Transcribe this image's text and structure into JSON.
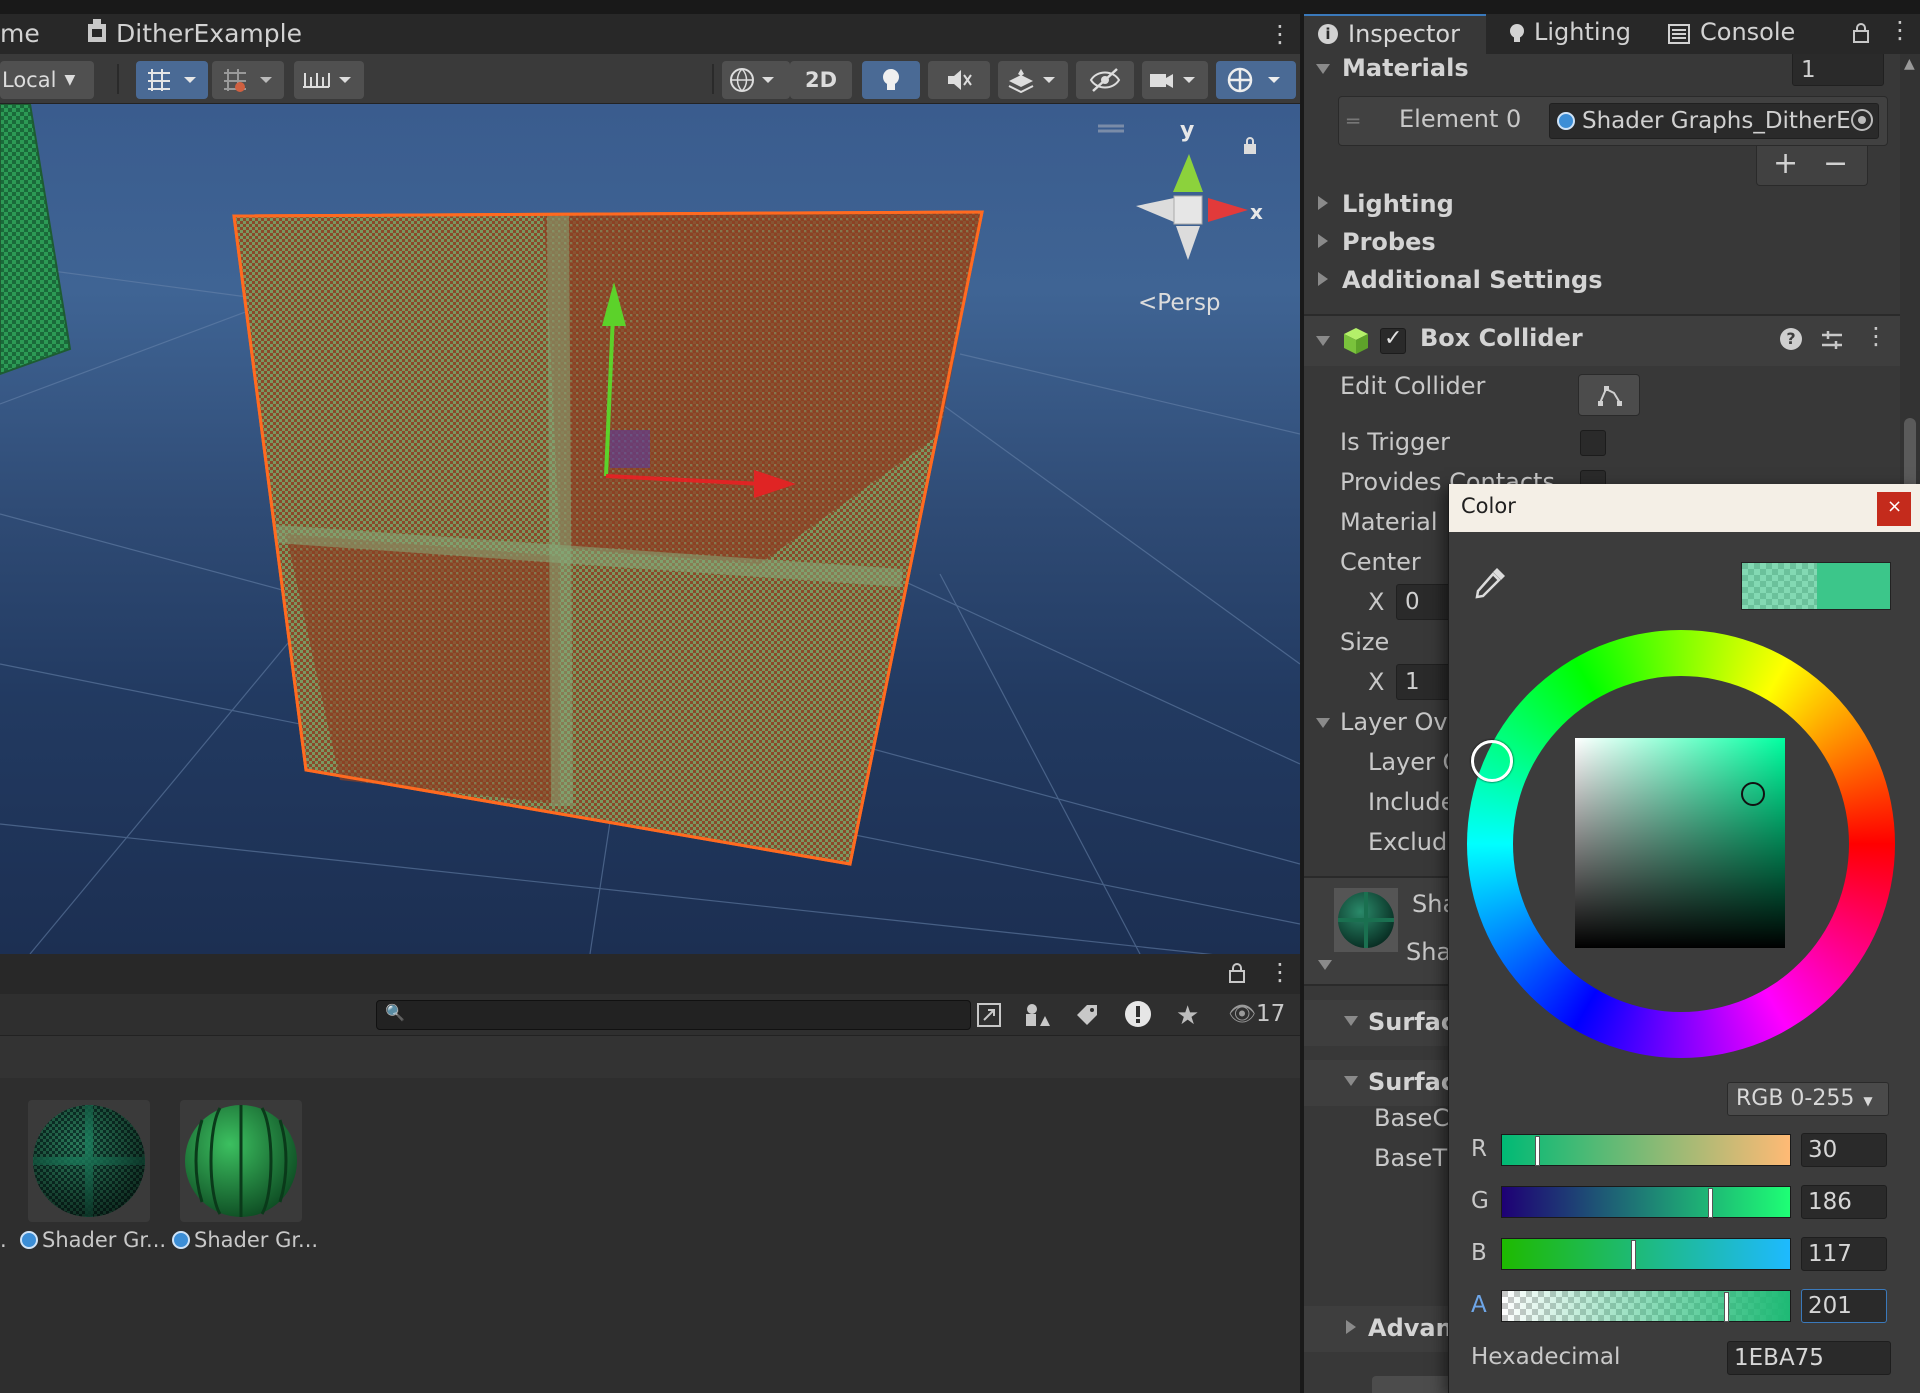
{
  "scene_window": {
    "tab_partial": "me",
    "tab_title": "DitherExample",
    "pivot_dropdown": "Local",
    "toggle_2d": "2D",
    "view_label": "Persp",
    "gizmo_y": "y",
    "gizmo_x": "x"
  },
  "project_window": {
    "search_placeholder": "",
    "hidden_count": "17",
    "assets": [
      {
        "label": "Shader Gr..."
      },
      {
        "label": "Shader Gr..."
      }
    ],
    "partial_label": "."
  },
  "inspector": {
    "tabs": [
      {
        "label": "Inspector",
        "icon": "info-icon"
      },
      {
        "label": "Lighting",
        "icon": "lightbulb-icon"
      },
      {
        "label": "Console",
        "icon": "console-icon"
      }
    ],
    "materials_label": "Materials",
    "materials_count": "1",
    "element0_label": "Element 0",
    "element0_value": "Shader Graphs_DitherE",
    "sections": [
      "Lighting",
      "Probes",
      "Additional Settings"
    ],
    "box_collider": {
      "title": "Box Collider",
      "edit_collider": "Edit Collider",
      "is_trigger": "Is Trigger",
      "provides_contacts": "Provides Contacts",
      "material": "Material",
      "center": "Center",
      "center_x_label": "X",
      "center_x": "0",
      "size": "Size",
      "size_x_label": "X",
      "size_x": "1",
      "layer_overrides": "Layer Ove",
      "layer_priority": "Layer O",
      "include_layers": "Include",
      "exclude_layers": "Exclude"
    },
    "material_header": {
      "name_line1": "Sha",
      "name_line2": "Sha"
    },
    "surface_options": "Surface",
    "surface_inputs": "Surface",
    "base_color": "BaseC",
    "base_texture": "BaseT",
    "advanced": "Advanc"
  },
  "color_picker": {
    "title": "Color",
    "mode": "RGB 0-255",
    "r_label": "R",
    "g_label": "G",
    "b_label": "B",
    "a_label": "A",
    "r": "30",
    "g": "186",
    "b": "117",
    "a": "201",
    "hex_label": "Hexadecimal",
    "hex": "1EBA75",
    "colors": {
      "current": "#1eba75",
      "hue": "#00ffa0"
    },
    "levels": {
      "r": 0.118,
      "g": 0.729,
      "b": 0.459,
      "a": 0.788
    }
  }
}
